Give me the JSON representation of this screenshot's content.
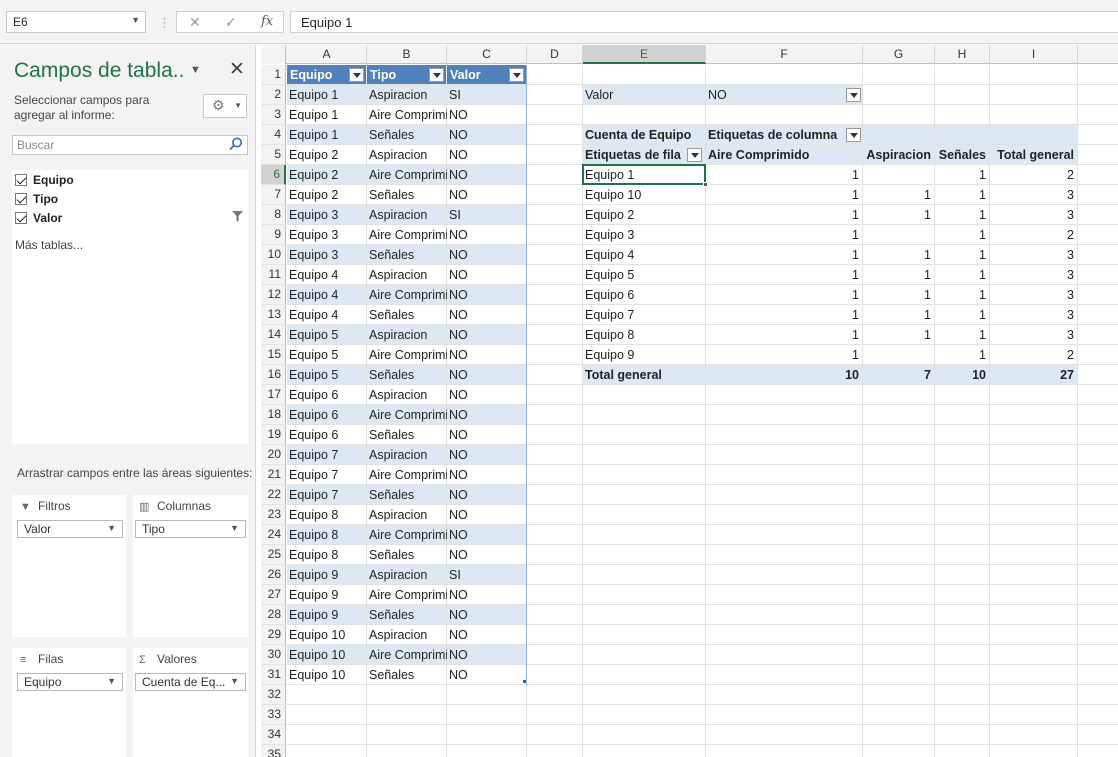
{
  "formula_bar": {
    "name_box": "E6",
    "formula": "Equipo 1",
    "cancel": "✕",
    "enter": "✓",
    "fx": "fx"
  },
  "pane": {
    "title": "Campos de tabla..",
    "subtitle": "Seleccionar campos para agregar al informe:",
    "search_placeholder": "Buscar",
    "fields": [
      "Equipo",
      "Tipo",
      "Valor"
    ],
    "more_tables": "Más tablas...",
    "drag_label": "Arrastrar campos entre las áreas siguientes:",
    "areas": {
      "filters": {
        "label": "Filtros",
        "item": "Valor"
      },
      "columns": {
        "label": "Columnas",
        "item": "Tipo"
      },
      "rows": {
        "label": "Filas",
        "item": "Equipo"
      },
      "values": {
        "label": "Valores",
        "item": "Cuenta de Eq..."
      }
    }
  },
  "sheet": {
    "columns": [
      "A",
      "B",
      "C",
      "D",
      "E",
      "F",
      "G",
      "H",
      "I"
    ],
    "selected_column": "E",
    "selected_row": 6,
    "rows": [
      1,
      2,
      3,
      4,
      5,
      6,
      7,
      8,
      9,
      10,
      11,
      12,
      13,
      14,
      15,
      16,
      17,
      18,
      19,
      20,
      21,
      22,
      23,
      24,
      25,
      26,
      27,
      28,
      29,
      30,
      31,
      32,
      33,
      34,
      35
    ],
    "table": {
      "headers": [
        "Equipo",
        "Tipo",
        "Valor"
      ],
      "rows": [
        [
          "Equipo 1",
          "Aspiracion",
          "SI"
        ],
        [
          "Equipo 1",
          "Aire Comprimido",
          "NO"
        ],
        [
          "Equipo 1",
          "Señales",
          "NO"
        ],
        [
          "Equipo 2",
          "Aspiracion",
          "NO"
        ],
        [
          "Equipo 2",
          "Aire Comprimido",
          "NO"
        ],
        [
          "Equipo 2",
          "Señales",
          "NO"
        ],
        [
          "Equipo 3",
          "Aspiracion",
          "SI"
        ],
        [
          "Equipo 3",
          "Aire Comprimido",
          "NO"
        ],
        [
          "Equipo 3",
          "Señales",
          "NO"
        ],
        [
          "Equipo 4",
          "Aspiracion",
          "NO"
        ],
        [
          "Equipo 4",
          "Aire Comprimido",
          "NO"
        ],
        [
          "Equipo 4",
          "Señales",
          "NO"
        ],
        [
          "Equipo 5",
          "Aspiracion",
          "NO"
        ],
        [
          "Equipo 5",
          "Aire Comprimido",
          "NO"
        ],
        [
          "Equipo 5",
          "Señales",
          "NO"
        ],
        [
          "Equipo 6",
          "Aspiracion",
          "NO"
        ],
        [
          "Equipo 6",
          "Aire Comprimido",
          "NO"
        ],
        [
          "Equipo 6",
          "Señales",
          "NO"
        ],
        [
          "Equipo 7",
          "Aspiracion",
          "NO"
        ],
        [
          "Equipo 7",
          "Aire Comprimido",
          "NO"
        ],
        [
          "Equipo 7",
          "Señales",
          "NO"
        ],
        [
          "Equipo 8",
          "Aspiracion",
          "NO"
        ],
        [
          "Equipo 8",
          "Aire Comprimido",
          "NO"
        ],
        [
          "Equipo 8",
          "Señales",
          "NO"
        ],
        [
          "Equipo 9",
          "Aspiracion",
          "SI"
        ],
        [
          "Equipo 9",
          "Aire Comprimido",
          "NO"
        ],
        [
          "Equipo 9",
          "Señales",
          "NO"
        ],
        [
          "Equipo 10",
          "Aspiracion",
          "NO"
        ],
        [
          "Equipo 10",
          "Aire Comprimido",
          "NO"
        ],
        [
          "Equipo 10",
          "Señales",
          "NO"
        ]
      ]
    },
    "pivot": {
      "filter_label": "Valor",
      "filter_value": "NO",
      "value_label": "Cuenta de Equipo",
      "col_labels": "Etiquetas de columna",
      "row_labels": "Etiquetas de fila",
      "col_headers": [
        "Aire Comprimido",
        "Aspiracion",
        "Señales",
        "Total general"
      ],
      "rows": [
        [
          "Equipo 1",
          "1",
          "",
          "1",
          "2"
        ],
        [
          "Equipo 10",
          "1",
          "1",
          "1",
          "3"
        ],
        [
          "Equipo 2",
          "1",
          "1",
          "1",
          "3"
        ],
        [
          "Equipo 3",
          "1",
          "",
          "1",
          "2"
        ],
        [
          "Equipo 4",
          "1",
          "1",
          "1",
          "3"
        ],
        [
          "Equipo 5",
          "1",
          "1",
          "1",
          "3"
        ],
        [
          "Equipo 6",
          "1",
          "1",
          "1",
          "3"
        ],
        [
          "Equipo 7",
          "1",
          "1",
          "1",
          "3"
        ],
        [
          "Equipo 8",
          "1",
          "1",
          "1",
          "3"
        ],
        [
          "Equipo 9",
          "1",
          "",
          "1",
          "2"
        ]
      ],
      "total": [
        "Total general",
        "10",
        "7",
        "10",
        "27"
      ]
    }
  }
}
